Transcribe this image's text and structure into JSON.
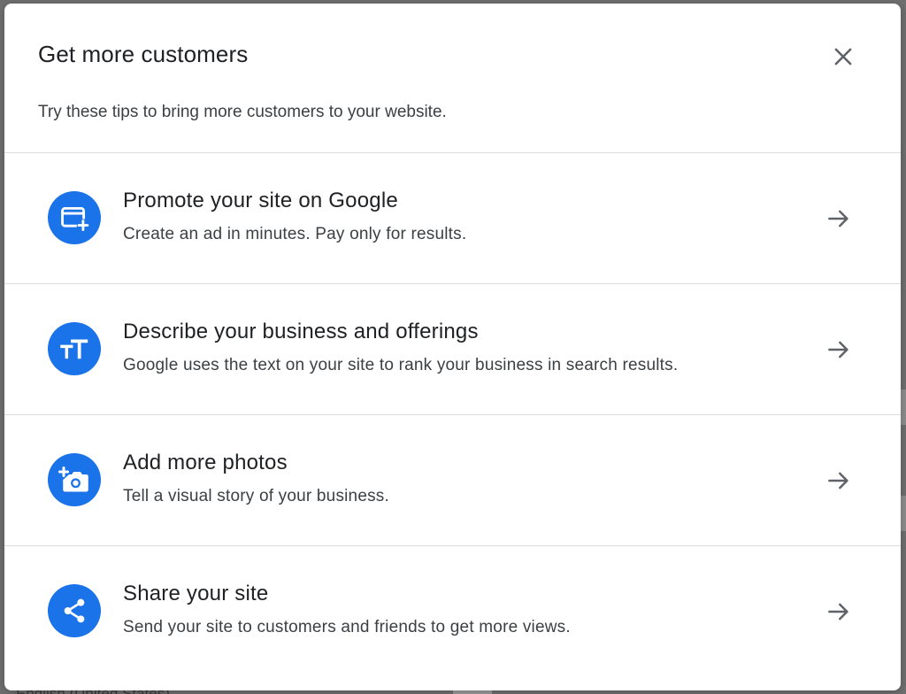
{
  "dialog": {
    "title": "Get more customers",
    "subtitle": "Try these tips to bring more customers to your website.",
    "close_icon": "close-icon"
  },
  "tips": [
    {
      "title": "Promote your site on Google",
      "description": "Create an ad in minutes. Pay only for results.",
      "icon": "ad-window-add-icon"
    },
    {
      "title": "Describe your business and offerings",
      "description": "Google uses the text on your site to rank your business in search results.",
      "icon": "text-size-icon"
    },
    {
      "title": "Add more photos",
      "description": "Tell a visual story of your business.",
      "icon": "add-photo-icon"
    },
    {
      "title": "Share your site",
      "description": "Send your site to customers and friends to get more views.",
      "icon": "share-icon"
    }
  ],
  "background": {
    "peek_text": "English (United States)"
  },
  "colors": {
    "accent": "#1a73e8",
    "divider": "#dadce0",
    "title_text": "#202124",
    "body_text": "#3c4043",
    "icon_gray": "#5f6368"
  }
}
